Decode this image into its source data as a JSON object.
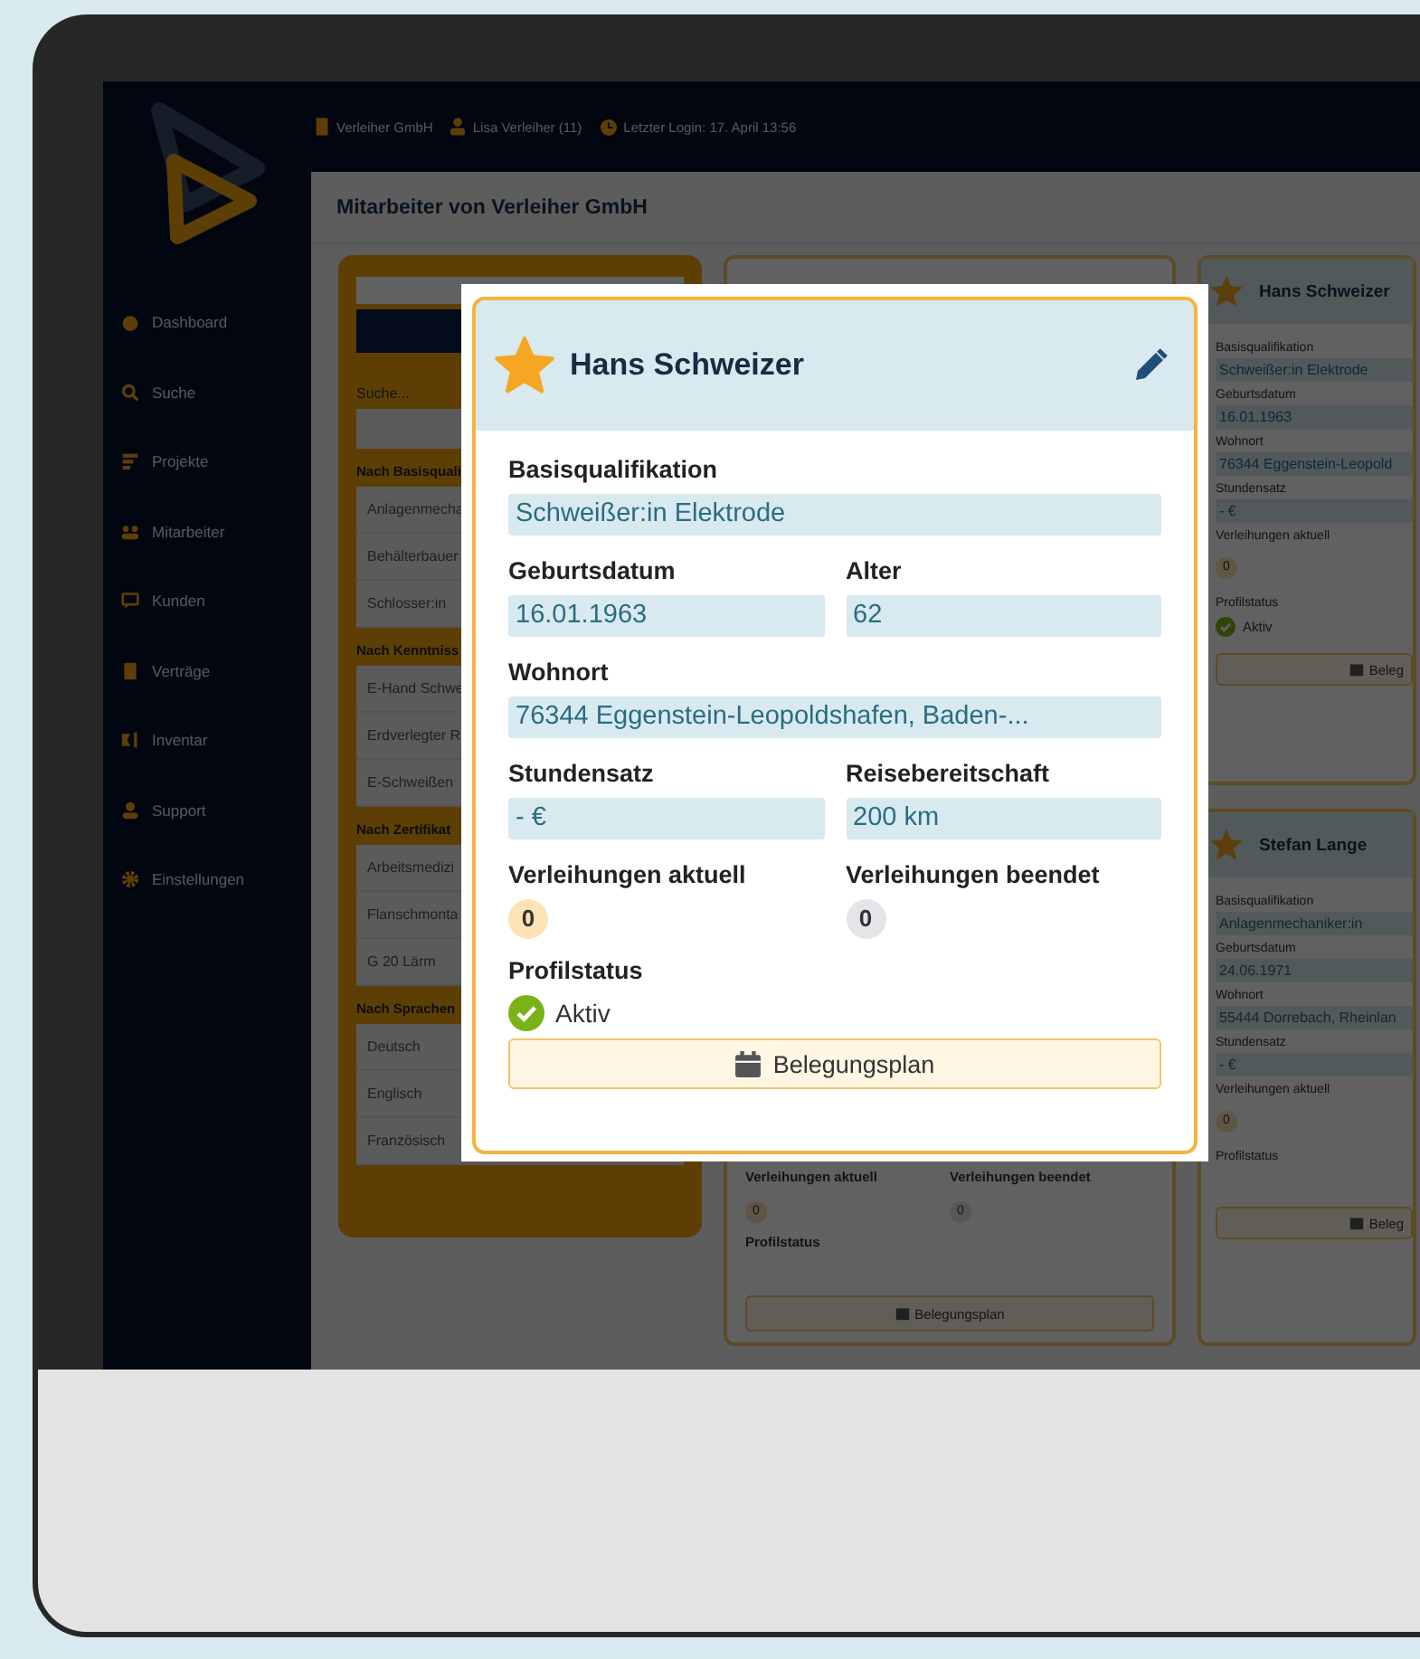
{
  "top_bar": {
    "company": "Verleiher GmbH",
    "user": "Lisa Verleiher (11)",
    "last_login": "Letzter Login: 17. April 13:56"
  },
  "sidebar": {
    "items": [
      "Dashboard",
      "Suche",
      "Projekte",
      "Mitarbeiter",
      "Kunden",
      "Verträge",
      "Inventar",
      "Support",
      "Einstellungen"
    ]
  },
  "page": {
    "title": "Mitarbeiter von Verleiher GmbH"
  },
  "filter_panel": {
    "search_label": "Suche...",
    "groups": [
      {
        "heading": "Nach Basisquali",
        "options": [
          "Anlagenmecha",
          "Behälterbauer",
          "Schlosser:in"
        ]
      },
      {
        "heading": "Nach Kenntniss",
        "options": [
          "E-Hand Schwe",
          "Erdverlegter R",
          "E-Schweißen"
        ]
      },
      {
        "heading": "Nach Zertifikat",
        "options": [
          "Arbeitsmedizi",
          "Flanschmonta",
          "G 20 Lärm"
        ]
      },
      {
        "heading": "Nach Sprachen",
        "options": [
          "Deutsch",
          "Englisch",
          "Französisch"
        ]
      }
    ]
  },
  "middle_card": {
    "counts": [
      {
        "label": "Verleihungen aktuell",
        "value": "0"
      },
      {
        "label": "Verleihungen beendet",
        "value": "0"
      }
    ],
    "status_label": "Profilstatus",
    "button": "Belegungsplan"
  },
  "popup": {
    "name": "Hans Schweizer",
    "rows": [
      [
        {
          "kind": "text",
          "label": "Basisqualifikation",
          "value": "Schweißer:in Elektrode"
        }
      ],
      [
        {
          "kind": "text",
          "label": "Geburtsdatum",
          "value": "16.01.1963"
        },
        {
          "kind": "text",
          "label": "Alter",
          "value": "62"
        }
      ],
      [
        {
          "kind": "text",
          "label": "Wohnort",
          "value": "76344 Eggenstein-Leopoldshafen, Baden-..."
        }
      ],
      [
        {
          "kind": "text",
          "label": "Stundensatz",
          "value": "- €"
        },
        {
          "kind": "text",
          "label": "Reisebereitschaft",
          "value": "200 km"
        }
      ],
      [
        {
          "kind": "count",
          "label": "Verleihungen aktuell",
          "value": "0",
          "color": "#fde3b5"
        },
        {
          "kind": "count",
          "label": "Verleihungen beendet",
          "value": "0",
          "color": "#e3e5e8"
        }
      ]
    ],
    "status_label": "Profilstatus",
    "status": {
      "label": "Aktiv",
      "active": true
    },
    "button": "Belegungsplan"
  },
  "right_cards": [
    {
      "name": "Hans Schweizer",
      "fields": [
        {
          "kind": "text",
          "label": "Basisqualifikation",
          "value": "Schweißer:in Elektrode"
        },
        {
          "kind": "text",
          "label": "Geburtsdatum",
          "value": "16.01.1963"
        },
        {
          "kind": "text",
          "label": "Wohnort",
          "value": "76344 Eggenstein-Leopold"
        },
        {
          "kind": "text",
          "label": "Stundensatz",
          "value": "- €"
        },
        {
          "kind": "count",
          "label": "Verleihungen aktuell",
          "value": "0"
        }
      ],
      "status_label": "Profilstatus",
      "status": {
        "label": "Aktiv",
        "active": true
      },
      "button": "Beleg"
    },
    {
      "name": "Stefan Lange",
      "fields": [
        {
          "kind": "text",
          "label": "Basisqualifikation",
          "value": "Anlagenmechaniker:in"
        },
        {
          "kind": "text",
          "label": "Geburtsdatum",
          "value": "24.06.1971"
        },
        {
          "kind": "text",
          "label": "Wohnort",
          "value": "55444 Dorrebach, Rheinlan"
        },
        {
          "kind": "text",
          "label": "Stundensatz",
          "value": "- €"
        },
        {
          "kind": "count",
          "label": "Verleihungen aktuell",
          "value": "0"
        }
      ],
      "status_label": "Profilstatus",
      "button": "Beleg"
    }
  ]
}
